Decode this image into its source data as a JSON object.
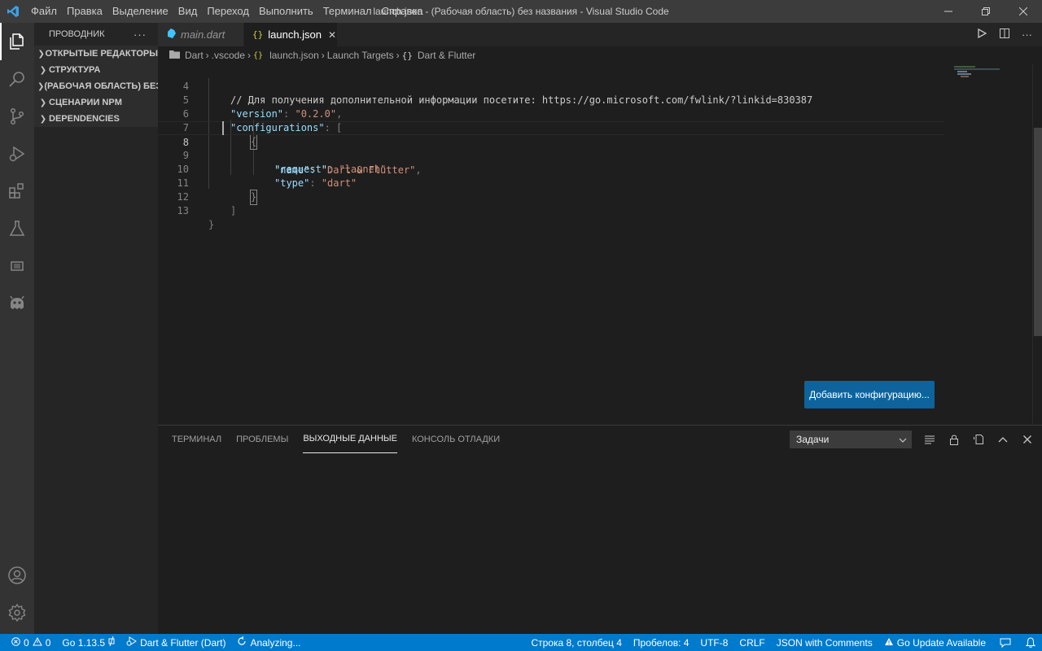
{
  "titlebar": {
    "menu": [
      "Файл",
      "Правка",
      "Выделение",
      "Вид",
      "Переход",
      "Выполнить",
      "Терминал",
      "Справка"
    ],
    "title": "launch.json - (Рабочая область) без названия - Visual Studio Code"
  },
  "sidebar": {
    "title": "ПРОВОДНИК",
    "more": "···",
    "sections": [
      {
        "label": "ОТКРЫТЫЕ РЕДАКТОРЫ"
      },
      {
        "label": "СТРУКТУРА"
      },
      {
        "label": "(РАБОЧАЯ ОБЛАСТЬ) БЕЗ ..."
      },
      {
        "label": "СЦЕНАРИИ NPM"
      },
      {
        "label": "DEPENDENCIES"
      }
    ]
  },
  "tabs": [
    {
      "label": "main.dart",
      "icon": "dart-icon",
      "active": false
    },
    {
      "label": "launch.json",
      "icon": "json-icon",
      "active": true,
      "close": "✕"
    }
  ],
  "breadcrumb": {
    "items": [
      "Dart",
      ".vscode",
      "launch.json",
      "Launch Targets",
      "Dart & Flutter"
    ],
    "obj_symbol": "{}"
  },
  "editor": {
    "line_numbers": [
      "4",
      "5",
      "6",
      "7",
      "8",
      "9",
      "10",
      "11",
      "12",
      "13"
    ],
    "comment": "// Для получения дополнительной информации посетите: https://go.microsoft.com/fwlink/?linkid=830387",
    "version_key": "\"version\"",
    "version_val": "\"0.2.0\"",
    "configurations_key": "\"configurations\"",
    "name_key": "\"name\"",
    "name_val": "\"Dart & Flutter\"",
    "request_key": "\"request\"",
    "request_val": "\"launch\"",
    "type_key": "\"type\"",
    "type_val": "\"dart\"",
    "colon": ": ",
    "comma": ",",
    "open_bracket": "[",
    "close_bracket": "]",
    "open_brace": "{",
    "close_brace": "}"
  },
  "add_config_button": "Добавить конфигурацию...",
  "panel": {
    "tabs": [
      "ТЕРМИНАЛ",
      "ПРОБЛЕМЫ",
      "ВЫХОДНЫЕ ДАННЫЕ",
      "КОНСОЛЬ ОТЛАДКИ"
    ],
    "active_tab": "ВЫХОДНЫЕ ДАННЫЕ",
    "select_value": "Задачи"
  },
  "statusbar": {
    "errors": "0",
    "warnings": "0",
    "go_version": "Go 1.13.5",
    "debug_config": "Dart & Flutter (Dart)",
    "analyzing": "Analyzing...",
    "position": "Строка 8, столбец 4",
    "spaces": "Пробелов: 4",
    "encoding": "UTF-8",
    "eol": "CRLF",
    "language": "JSON with Comments",
    "go_update": "Go Update Available"
  },
  "colors": {
    "accent": "#007acc",
    "button": "#0e639c",
    "titlebar": "#3c3c3c",
    "activitybar": "#333333",
    "sidebar": "#252526",
    "editor": "#1e1e1e"
  }
}
